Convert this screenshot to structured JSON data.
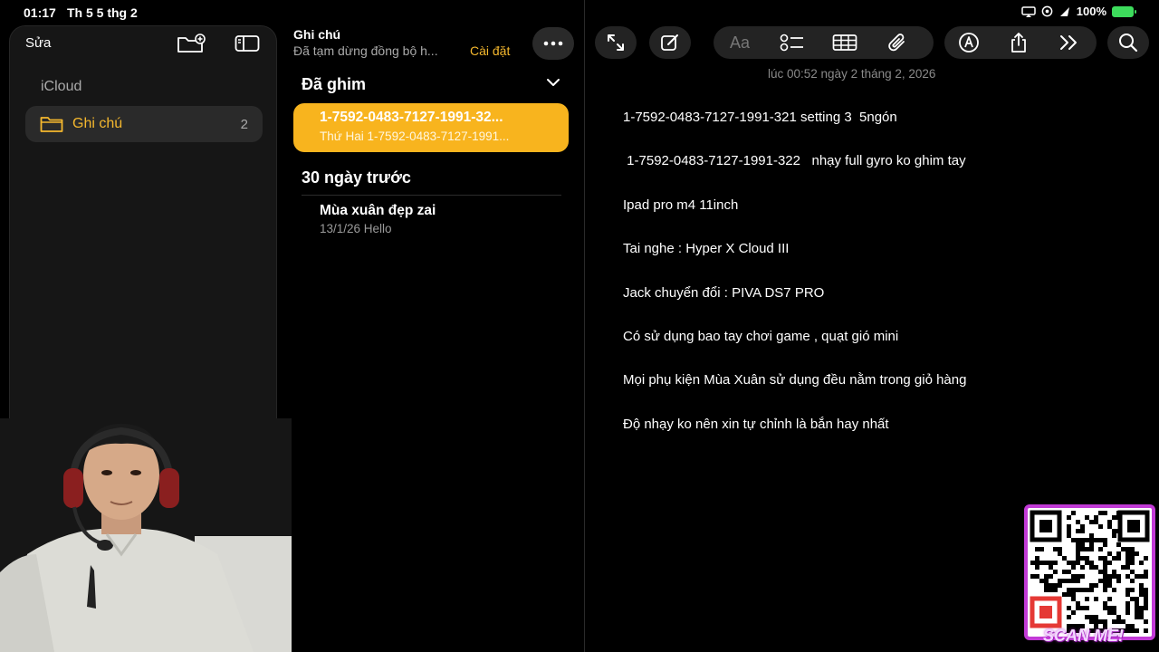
{
  "status_bar": {
    "time": "01:17",
    "date": "Th 5 5 thg 2",
    "battery": "100%"
  },
  "sidebar": {
    "edit_label": "Sửa",
    "account": "iCloud",
    "folder": {
      "label": "Ghi chú",
      "count": "2"
    }
  },
  "list": {
    "title": "Ghi chú",
    "subtitle": "Đã tạm dừng đồng bộ h...",
    "settings_link": "Cài đặt",
    "pinned_header": "Đã ghim",
    "pinned_note": {
      "title": "1-7592-0483-7127-1991-32...",
      "subtitle": "Thứ Hai  1-7592-0483-7127-1991..."
    },
    "older_header": "30 ngày trước",
    "notes": [
      {
        "title": "Mùa xuân đẹp zai",
        "subtitle": "13/1/26  Hello"
      }
    ]
  },
  "editor": {
    "format_label": "Aa",
    "timestamp": "lúc 00:52 ngày 2 tháng 2, 2026",
    "lines": [
      "1-7592-0483-7127-1991-321 setting 3  5ngón",
      " 1-7592-0483-7127-1991-322   nhạy full gyro ko ghim tay",
      "Ipad pro m4 11inch",
      "Tai nghe : Hyper X Cloud III",
      "Jack chuyển đổi : PIVA DS7 PRO",
      "Có sử dụng bao tay chơi game , quạt gió mini",
      "Mọi phụ kiện Mùa Xuân sử dụng đều nằm trong giỏ hàng",
      "Độ nhạy ko nên xin tự chỉnh là bắn hay nhất"
    ]
  },
  "overlay": {
    "qr_label": "SCAN ME!"
  },
  "colors": {
    "accent": "#f8b41e",
    "background": "#000000",
    "sidebar_bg": "#161616",
    "qr_border": "#c23ad6"
  },
  "icons": [
    "new-folder-icon",
    "sidebar-toggle-icon",
    "more-icon",
    "chevron-down-icon",
    "folder-icon",
    "expand-icon",
    "compose-icon",
    "checklist-icon",
    "table-icon",
    "attachment-icon",
    "markup-icon",
    "share-icon",
    "more-tools-icon",
    "search-icon",
    "wifi-icon",
    "battery-icon"
  ]
}
